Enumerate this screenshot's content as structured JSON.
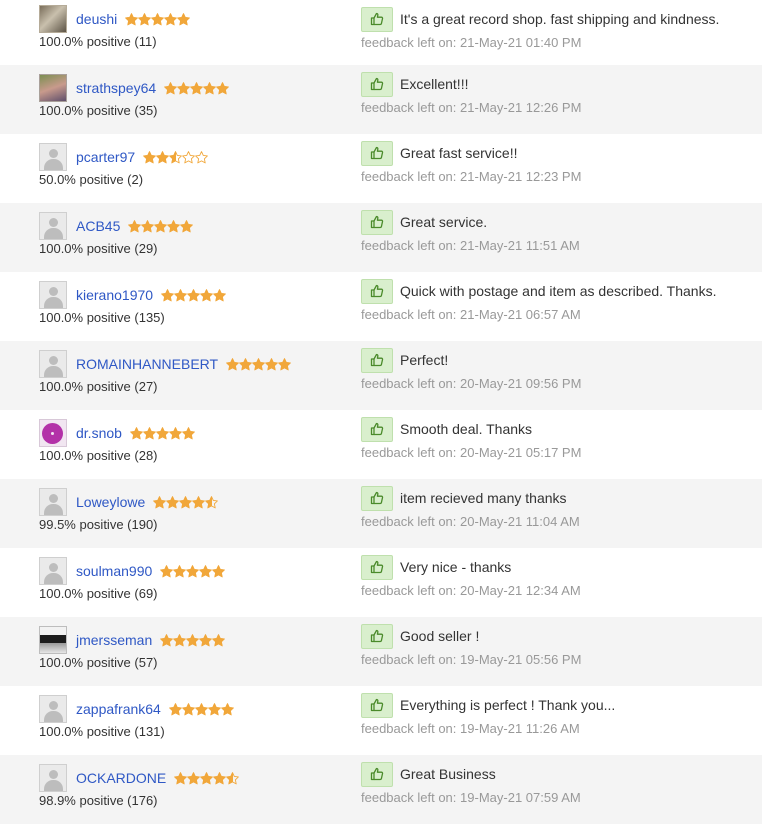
{
  "colors": {
    "username_link": "#2f58c5",
    "star_filled": "#f1a73a",
    "star_empty_outline": "#f1a73a",
    "thumb_background": "#d9efcd",
    "thumb_icon": "#4a8a2a",
    "date_text": "#999999",
    "row_alt_background": "#f4f4f4"
  },
  "icons": {
    "rating": "star-icon",
    "feedback_type": "thumbs-up-icon",
    "default_avatar": "user-avatar-icon"
  },
  "date_prefix": "feedback left on:",
  "feedback": [
    {
      "username": "deushi",
      "stars": 5,
      "positive": "100.0% positive (11)",
      "comment": "It's a great record shop. fast shipping and kindness.",
      "date": "21-May-21 01:40 PM",
      "avatar": "photo"
    },
    {
      "username": "strathspey64",
      "stars": 5,
      "positive": "100.0% positive (35)",
      "comment": "Excellent!!!",
      "date": "21-May-21 12:26 PM",
      "avatar": "photo"
    },
    {
      "username": "pcarter97",
      "stars": 2.5,
      "positive": "50.0% positive (2)",
      "comment": "Great fast service!!",
      "date": "21-May-21 12:23 PM",
      "avatar": "default"
    },
    {
      "username": "ACB45",
      "stars": 5,
      "positive": "100.0% positive (29)",
      "comment": "Great service.",
      "date": "21-May-21 11:51 AM",
      "avatar": "default"
    },
    {
      "username": "kierano1970",
      "stars": 5,
      "positive": "100.0% positive (135)",
      "comment": "Quick with postage and item as described. Thanks.",
      "date": "21-May-21 06:57 AM",
      "avatar": "default"
    },
    {
      "username": "ROMAINHANNEBERT",
      "stars": 5,
      "positive": "100.0% positive (27)",
      "comment": "Perfect!",
      "date": "20-May-21 09:56 PM",
      "avatar": "default"
    },
    {
      "username": "dr.snob",
      "stars": 5,
      "positive": "100.0% positive (28)",
      "comment": "Smooth deal. Thanks",
      "date": "20-May-21 05:17 PM",
      "avatar": "photo"
    },
    {
      "username": "Loweylowe",
      "stars": 4.5,
      "positive": "99.5% positive (190)",
      "comment": "item recieved many thanks",
      "date": "20-May-21 11:04 AM",
      "avatar": "default"
    },
    {
      "username": "soulman990",
      "stars": 5,
      "positive": "100.0% positive (69)",
      "comment": "Very nice - thanks",
      "date": "20-May-21 12:34 AM",
      "avatar": "default"
    },
    {
      "username": "jmersseman",
      "stars": 5,
      "positive": "100.0% positive (57)",
      "comment": "Good seller !",
      "date": "19-May-21 05:56 PM",
      "avatar": "photo"
    },
    {
      "username": "zappafrank64",
      "stars": 5,
      "positive": "100.0% positive (131)",
      "comment": "Everything is perfect ! Thank you...",
      "date": "19-May-21 11:26 AM",
      "avatar": "default"
    },
    {
      "username": "OCKARDONE",
      "stars": 4.5,
      "positive": "98.9% positive (176)",
      "comment": "Great Business",
      "date": "19-May-21 07:59 AM",
      "avatar": "default"
    }
  ]
}
